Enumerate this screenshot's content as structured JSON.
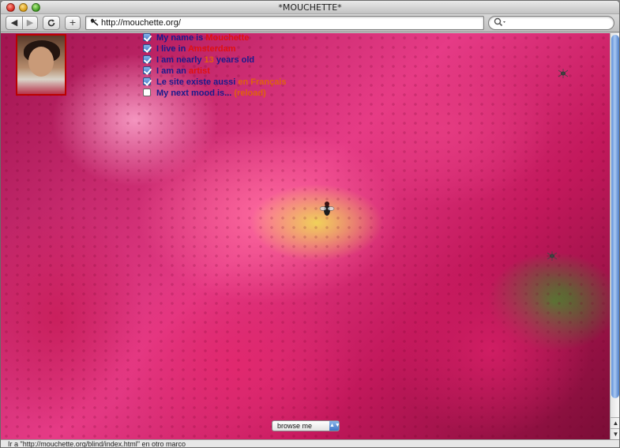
{
  "window": {
    "title": "*MOUCHETTE*"
  },
  "toolbar": {
    "back_icon": "◀",
    "forward_icon": "▶",
    "reload_icon": "reload-icon",
    "add_icon": "+",
    "url": "http://mouchette.org/",
    "search_icon": "magnifier-icon"
  },
  "page": {
    "menu": [
      {
        "checked": true,
        "prefix": "My name is ",
        "highlight": "Mouchette",
        "suffix": ""
      },
      {
        "checked": true,
        "prefix": "I live in ",
        "highlight": "Amsterdam",
        "suffix": ""
      },
      {
        "checked": true,
        "prefix": "I am nearly ",
        "highlight": "13",
        "suffix": " years old"
      },
      {
        "checked": true,
        "prefix": "I am an ",
        "highlight": "artist",
        "suffix": ""
      },
      {
        "checked": true,
        "prefix": "Le site existe aussi ",
        "highlight": "en Français",
        "suffix": ""
      },
      {
        "checked": false,
        "prefix": "My next mood is... ",
        "highlight": "(reload)",
        "suffix": ""
      }
    ],
    "browse_select": "browse me"
  },
  "status": {
    "text": "Ir a \"http://mouchette.org/blind/index.html\" en otro marco"
  },
  "colors": {
    "menu_text": "#1a1a8c",
    "highlight": "#e01010",
    "accent_blue": "#3d74c7"
  }
}
